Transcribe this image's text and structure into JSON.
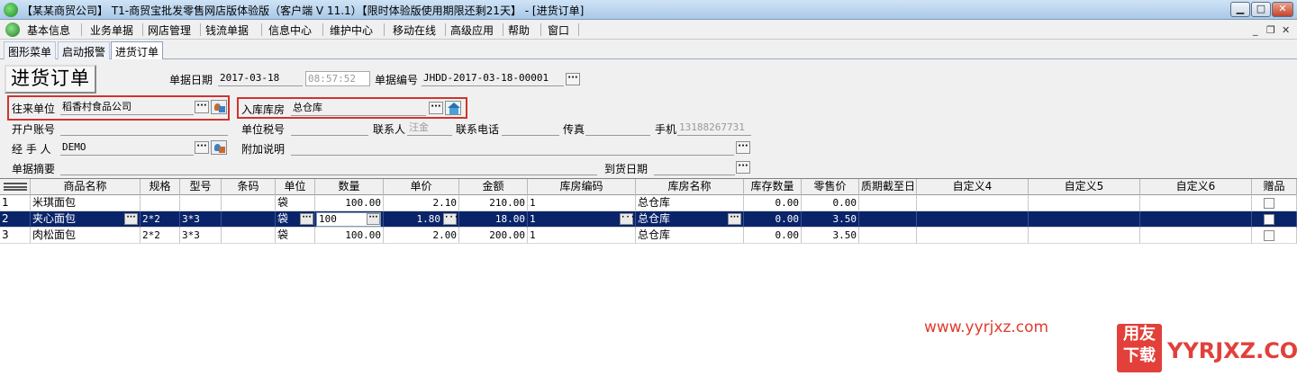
{
  "window": {
    "title": "【某某商贸公司】 T1-商贸宝批发零售网店版体验版（客户端 V 11.1）【限时体验版使用期限还剩21天】 - [进货订单]",
    "btn_min": "▁",
    "btn_max": "□",
    "btn_close": "✕"
  },
  "menu": {
    "items": [
      "基本信息",
      "业务单据",
      "网店管理",
      "钱流单据",
      "信息中心",
      "维护中心",
      "移动在线",
      "高级应用",
      "帮助",
      "窗口"
    ],
    "mdi_min": "_",
    "mdi_restore": "❐",
    "mdi_close": "✕"
  },
  "tabs": [
    "图形菜单",
    "启动报警",
    "进货订单"
  ],
  "form": {
    "doc_title": "进货订单",
    "date_label": "单据日期",
    "date_value": "2017-03-18",
    "time_value": "08:57:52",
    "docno_label": "单据编号",
    "docno_value": "JHDD-2017-03-18-00001",
    "partner_label": "往来单位",
    "partner_value": "稻香村食品公司",
    "warehouse_label": "入库库房",
    "warehouse_value": "总仓库",
    "account_label": "开户账号",
    "taxno_label": "单位税号",
    "contact_label": "联系人",
    "contact_value": "汪金",
    "phone_label": "联系电话",
    "fax_label": "传真",
    "mobile_label": "手机",
    "mobile_value": "13188267731",
    "handler_label": "经 手 人",
    "handler_value": "DEMO",
    "note_label": "附加说明",
    "summary_label": "单据摘要",
    "arrival_label": "到货日期",
    "ellipsis": "···"
  },
  "grid": {
    "headers": [
      "商品名称",
      "规格",
      "型号",
      "条码",
      "单位",
      "数量",
      "单价",
      "金额",
      "库房编码",
      "库房名称",
      "库存数量",
      "零售价",
      "质期截至日",
      "自定义4",
      "自定义5",
      "自定义6",
      "赠品"
    ],
    "rows": [
      {
        "no": "1",
        "name": "米琪面包",
        "spec": "",
        "model": "",
        "barcode": "",
        "unit": "袋",
        "qty": "100.00",
        "price": "2.10",
        "amount": "210.00",
        "wh_code": "1",
        "wh_name": "总仓库",
        "stock": "0.00",
        "retail": "0.00"
      },
      {
        "no": "2",
        "name": "夹心面包",
        "spec": "2*2",
        "model": "3*3",
        "barcode": "",
        "unit": "袋",
        "qty": "100",
        "price": "1.80",
        "amount": "18.00",
        "wh_code": "1",
        "wh_name": "总仓库",
        "stock": "0.00",
        "retail": "3.50"
      },
      {
        "no": "3",
        "name": "肉松面包",
        "spec": "2*2",
        "model": "3*3",
        "barcode": "",
        "unit": "袋",
        "qty": "100.00",
        "price": "2.00",
        "amount": "200.00",
        "wh_code": "1",
        "wh_name": "总仓库",
        "stock": "0.00",
        "retail": "3.50"
      }
    ]
  },
  "watermark": {
    "url": "www.yyrjxz.com",
    "logo": "用友下载",
    "site": "YYRJXZ.COM"
  },
  "colors": {
    "selection": "#0a246a",
    "highlight_box": "#d0342c"
  }
}
